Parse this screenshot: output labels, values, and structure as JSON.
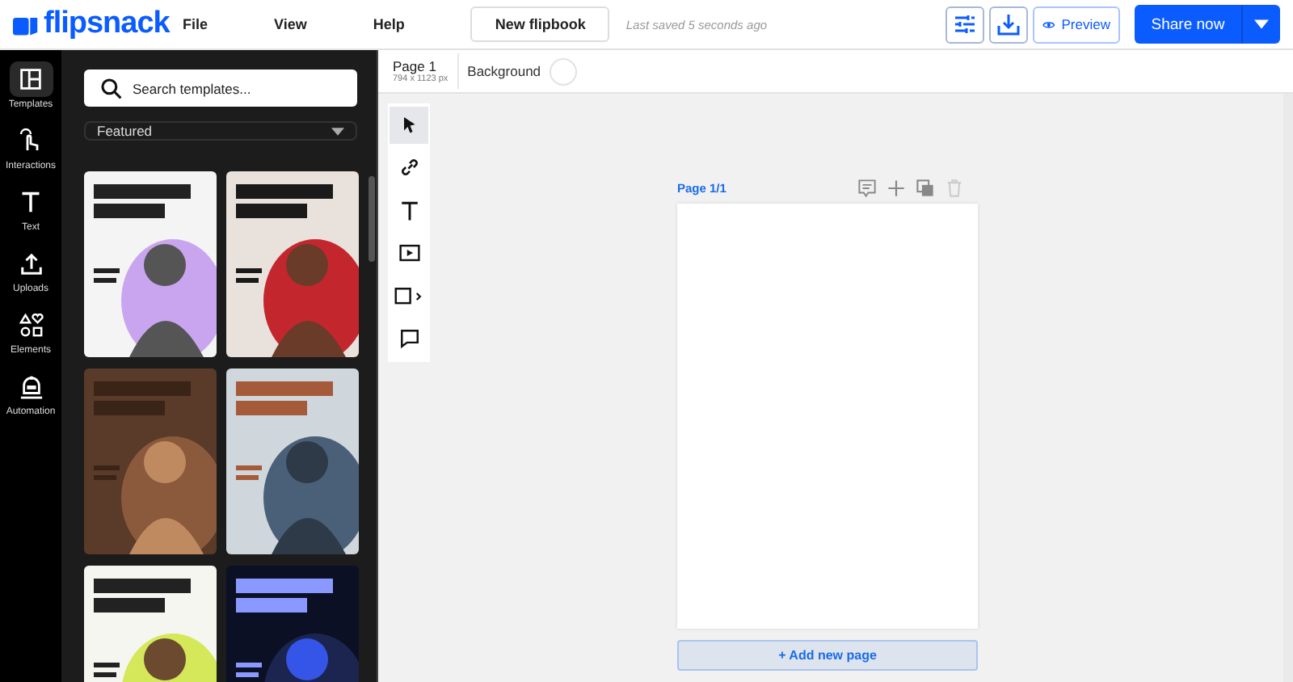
{
  "header": {
    "logo": "flipsnack",
    "menu": [
      "File",
      "View",
      "Help"
    ],
    "title_button": "New flipbook",
    "save_status": "Last saved 5 seconds ago",
    "preview_button": "Preview",
    "share_button": "Share now"
  },
  "rail": [
    {
      "label": "Templates",
      "selected": true
    },
    {
      "label": "Interactions",
      "selected": false
    },
    {
      "label": "Text",
      "selected": false
    },
    {
      "label": "Uploads",
      "selected": false
    },
    {
      "label": "Elements",
      "selected": false
    },
    {
      "label": "Automation",
      "selected": false
    }
  ],
  "templates_panel": {
    "search": {
      "placeholder": "Search templates..."
    },
    "filter": "Featured"
  },
  "page_bar": {
    "page": "Page 1",
    "size": "794 x 1123 px",
    "background_label": "Background"
  },
  "tools": [
    {
      "selected": true
    },
    {
      "selected": false
    },
    {
      "selected": false
    },
    {
      "selected": false
    },
    {
      "selected": false
    },
    {
      "selected": false
    }
  ],
  "canvas": {
    "page_label": "Page 1/1",
    "add_page_button": "+ Add new page"
  }
}
